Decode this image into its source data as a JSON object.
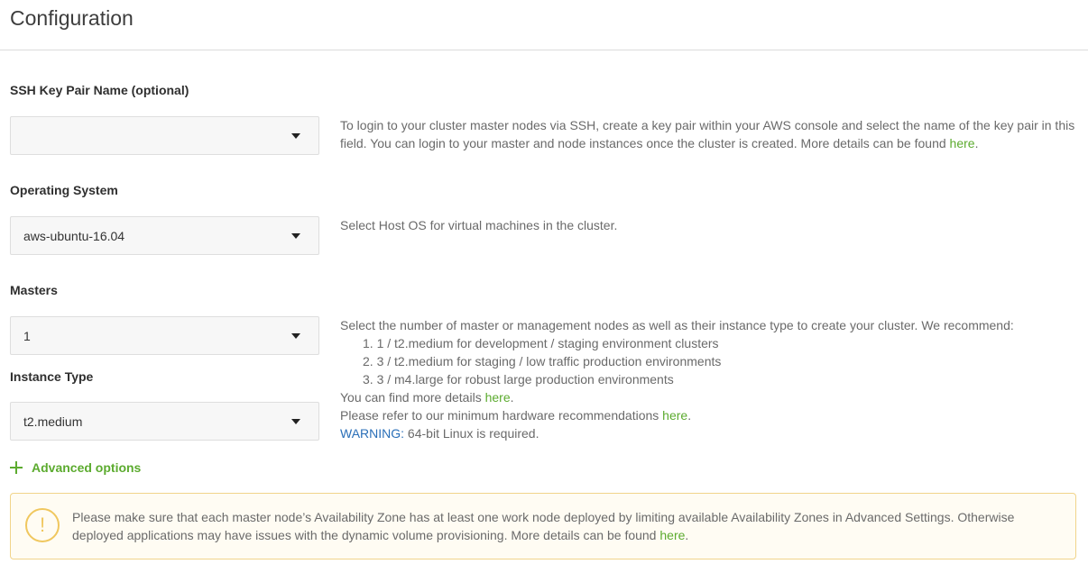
{
  "title": "Configuration",
  "ssh": {
    "label": "SSH Key Pair Name (optional)",
    "value": "",
    "help_text": "To login to your cluster master nodes via SSH, create a key pair within your AWS console and select the name of the key pair in this field. You can login to your master and node instances once the cluster is created. More details can be found ",
    "help_link": "here",
    "help_end": "."
  },
  "os": {
    "label": "Operating System",
    "value": "aws-ubuntu-16.04",
    "help_text": "Select Host OS for virtual machines in the cluster."
  },
  "masters": {
    "label": "Masters",
    "value": "1",
    "help_intro": "Select the number of master or management nodes as well as their instance type to create your cluster. We recommend:",
    "recommendations": [
      "1. 1 / t2.medium for development / staging environment clusters",
      "2. 3 / t2.medium for staging / low traffic production environments",
      "3. 3 / m4.large for robust large production environments"
    ],
    "details_text": "You can find more details ",
    "details_link": "here",
    "details_end": ".",
    "hardware_text": "Please refer to our minimum hardware recommendations ",
    "hardware_link": "here",
    "hardware_end": ".",
    "warning_label": "WARNING:",
    "warning_text": " 64-bit Linux is required."
  },
  "instance_type": {
    "label": "Instance Type",
    "value": "t2.medium"
  },
  "advanced_options": {
    "label": "Advanced options",
    "icon": "plus-icon"
  },
  "alert": {
    "icon": "exclamation-icon",
    "icon_glyph": "!",
    "text": "Please make sure that each master node’s Availability Zone has at least one work node deployed by limiting available Availability Zones in Advanced Settings. Otherwise deployed applications may have issues with the dynamic volume provisioning. More details can be found ",
    "link": "here",
    "end": "."
  },
  "colors": {
    "link": "#5cab2f",
    "warning": "#2a6fb8",
    "alert_border": "#f1d48a",
    "alert_icon": "#f0c75e"
  }
}
